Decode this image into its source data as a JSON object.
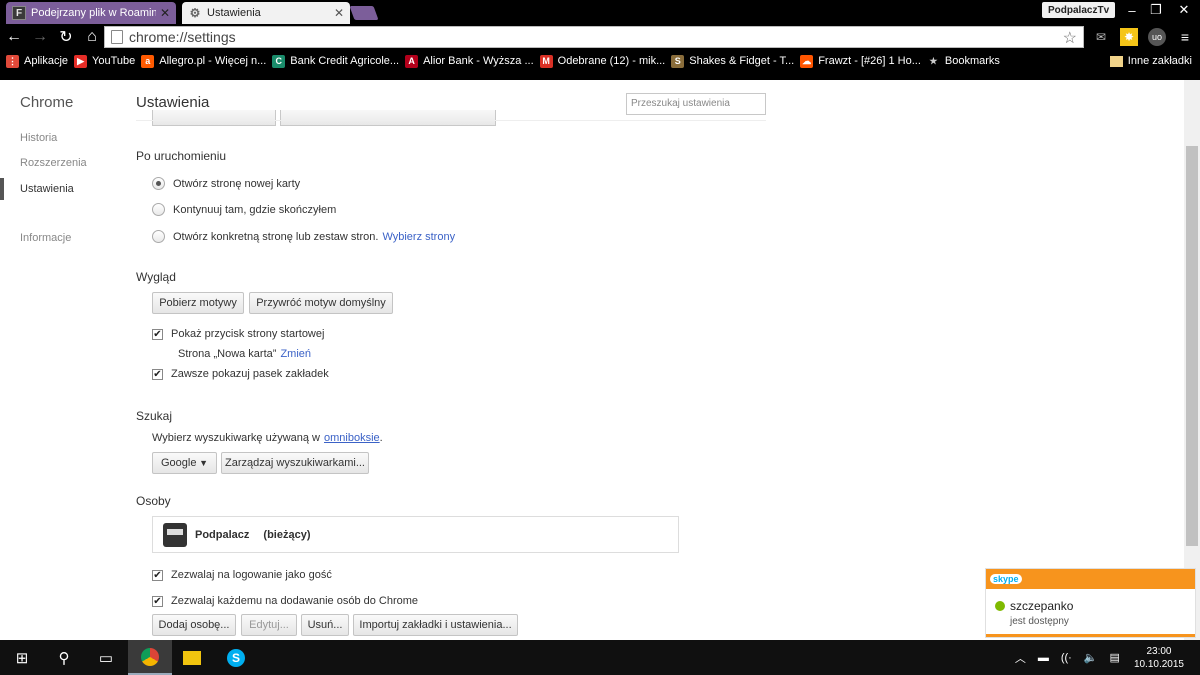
{
  "tabs": [
    {
      "favicon": "F",
      "label": "Podejrzany plik w Roamin"
    },
    {
      "favicon": "gear-icon",
      "label": "Ustawienia"
    }
  ],
  "profile_button": "PodpalaczTv",
  "omnibox": {
    "url": "chrome://settings"
  },
  "bookmarks": [
    {
      "label": "Aplikacje",
      "color": "#e04a3a"
    },
    {
      "label": "YouTube",
      "color": "#e52d27"
    },
    {
      "label": "Allegro.pl - Więcej n...",
      "color": "#ff5a00"
    },
    {
      "label": "Bank Credit Agricole...",
      "color": "#1a8c6b"
    },
    {
      "label": "Alior Bank - Wyższa ...",
      "color": "#b3001b"
    },
    {
      "label": "Odebrane (12) - mik...",
      "color": "#d93025"
    },
    {
      "label": "Shakes & Fidget - T...",
      "color": "#8a6d3b"
    },
    {
      "label": "Frawzt - [#26] 1 Ho...",
      "color": "#ff5500"
    },
    {
      "label": "Bookmarks",
      "color": "#999999"
    }
  ],
  "other_bookmarks": "Inne zakładki",
  "sidebar": {
    "title": "Chrome",
    "items": [
      "Historia",
      "Rozszerzenia",
      "Ustawienia",
      "Informacje"
    ]
  },
  "settings": {
    "title": "Ustawienia",
    "search_placeholder": "Przeszukaj ustawienia",
    "startup": {
      "heading": "Po uruchomieniu",
      "options": [
        "Otwórz stronę nowej karty",
        "Kontynuuj tam, gdzie skończyłem",
        "Otwórz konkretną stronę lub zestaw stron."
      ],
      "selected": 0,
      "link": "Wybierz strony"
    },
    "appearance": {
      "heading": "Wygląd",
      "get_themes": "Pobierz motywy",
      "reset_theme": "Przywróć motyw domyślny",
      "show_home": "Pokaż przycisk strony startowej",
      "home_page_text": "Strona „Nowa karta”",
      "change_link": "Zmień",
      "show_bookmarks": "Zawsze pokazuj pasek zakładek"
    },
    "search": {
      "heading": "Szukaj",
      "desc_prefix": "Wybierz wyszukiwarkę używaną w",
      "desc_link": "omniboksie",
      "desc_suffix": ".",
      "engine": "Google",
      "manage": "Zarządzaj wyszukiwarkami..."
    },
    "people": {
      "heading": "Osoby",
      "profile_name": "Podpalacz",
      "profile_current": "(bieżący)",
      "guest": "Zezwalaj na logowanie jako gość",
      "anyone_add": "Zezwalaj każdemu na dodawanie osób do Chrome",
      "add": "Dodaj osobę...",
      "edit": "Edytuj...",
      "remove": "Usuń...",
      "import": "Importuj zakładki i ustawienia..."
    }
  },
  "skype": {
    "logo": "skype",
    "user": "szczepanko",
    "status": "jest dostępny"
  },
  "clock": {
    "time": "23:00",
    "date": "10.10.2015"
  }
}
